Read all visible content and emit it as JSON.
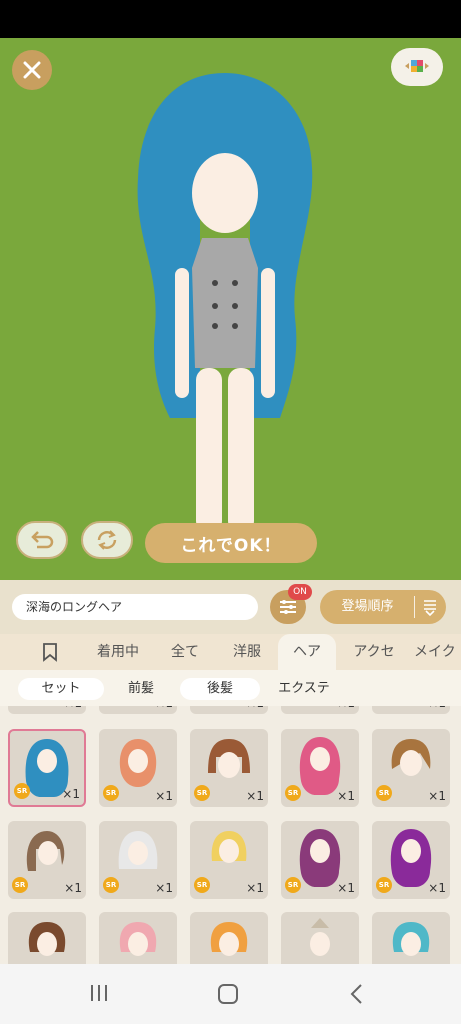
{
  "dressup": {
    "ok_label": "これでOK！",
    "item_name": "深海のロングヘア",
    "filter_badge": "ON",
    "sort_label": "登場順序"
  },
  "tabs": [
    "着用中",
    "全て",
    "洋服",
    "ヘア",
    "アクセ",
    "メイク"
  ],
  "subtabs": [
    "セット",
    "前髪",
    "後髪",
    "エクステ"
  ],
  "items": [
    {
      "rarity": "SR",
      "count": "×1",
      "hair_color": "#2f8fc0"
    },
    {
      "rarity": "SR",
      "count": "×1",
      "hair_color": "#e8906a"
    },
    {
      "rarity": "SR",
      "count": "×1",
      "hair_color": "#9a5a36"
    },
    {
      "rarity": "SR",
      "count": "×1",
      "hair_color": "#e05a86"
    },
    {
      "rarity": "SR",
      "count": "×1",
      "hair_color": "#a8743e"
    },
    {
      "rarity": "SR",
      "count": "×1",
      "hair_color": "#8a6a50"
    },
    {
      "rarity": "SR",
      "count": "×1",
      "hair_color": "#e8e8e8"
    },
    {
      "rarity": "SR",
      "count": "×1",
      "hair_color": "#f0d060"
    },
    {
      "rarity": "SR",
      "count": "×1",
      "hair_color": "#8a3a7a"
    },
    {
      "rarity": "SR",
      "count": "×1",
      "hair_color": "#8a2a9a"
    }
  ],
  "colors": {
    "stage": "#7aa83c",
    "accent": "#d6b06e",
    "hair": "#2f8fc0"
  }
}
